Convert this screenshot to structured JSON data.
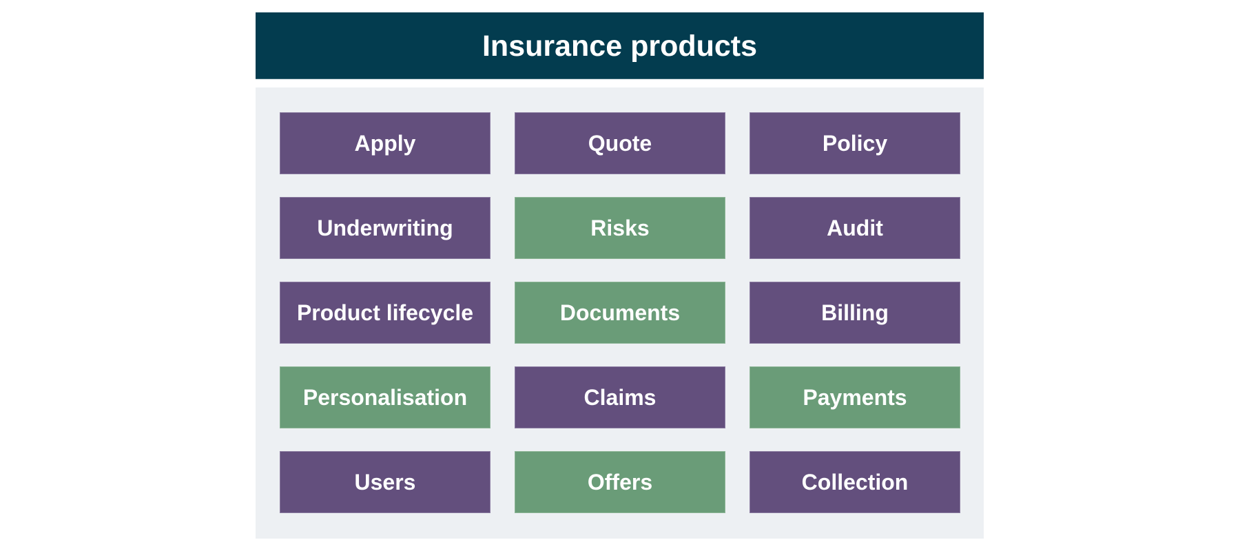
{
  "diagram": {
    "title": "Insurance products",
    "colors": {
      "header": "#033c4f",
      "panel": "#edf0f3",
      "core": "#634f7d",
      "extension": "#6a9c78",
      "text": "#ffffff"
    },
    "items": [
      {
        "label": "Apply",
        "color": "purple"
      },
      {
        "label": "Quote",
        "color": "purple"
      },
      {
        "label": "Policy",
        "color": "purple"
      },
      {
        "label": "Underwriting",
        "color": "purple"
      },
      {
        "label": "Risks",
        "color": "green"
      },
      {
        "label": "Audit",
        "color": "purple"
      },
      {
        "label": "Product lifecycle",
        "color": "purple"
      },
      {
        "label": "Documents",
        "color": "green"
      },
      {
        "label": "Billing",
        "color": "purple"
      },
      {
        "label": "Personalisation",
        "color": "green"
      },
      {
        "label": "Claims",
        "color": "purple"
      },
      {
        "label": "Payments",
        "color": "green"
      },
      {
        "label": "Users",
        "color": "purple"
      },
      {
        "label": "Offers",
        "color": "green"
      },
      {
        "label": "Collection",
        "color": "purple"
      }
    ]
  }
}
